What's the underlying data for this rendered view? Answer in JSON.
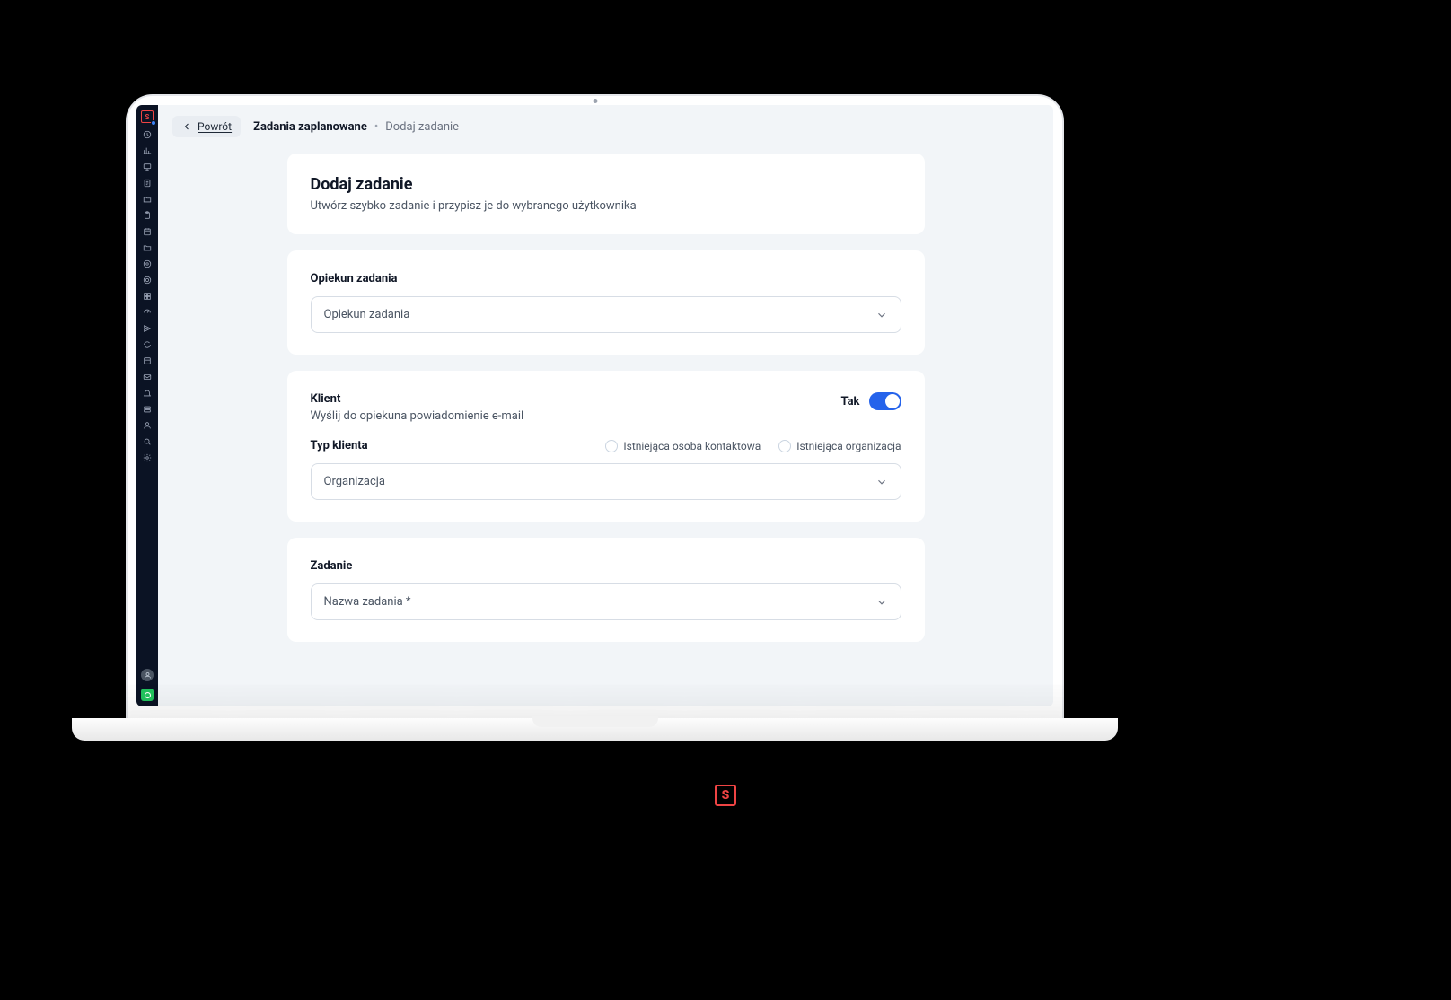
{
  "topbar": {
    "back_label": "Powrót"
  },
  "breadcrumb": {
    "root": "Zadania zaplanowane",
    "current": "Dodaj zadanie"
  },
  "header_panel": {
    "title": "Dodaj zadanie",
    "subtitle": "Utwórz szybko zadanie i przypisz je do wybranego użytkownika"
  },
  "caretaker": {
    "section_label": "Opiekun zadania",
    "placeholder": "Opiekun zadania"
  },
  "client": {
    "section_label": "Klient",
    "notify_label": "Wyślij do opiekuna powiadomienie e-mail",
    "toggle_label": "Tak",
    "type_label": "Typ klienta",
    "radio_contact": "Istniejąca osoba kontaktowa",
    "radio_org": "Istniejąca organizacja",
    "type_placeholder": "Organizacja"
  },
  "task": {
    "section_label": "Zadanie",
    "name_placeholder": "Nazwa zadania *"
  },
  "icons": {
    "sidebar": [
      "clock-icon",
      "chart-icon",
      "monitor-icon",
      "document-icon",
      "folder-icon",
      "clipboard-icon",
      "calendar-icon",
      "folder2-icon",
      "at-icon",
      "target-icon",
      "grid-icon",
      "dashboard-icon",
      "send-icon",
      "refresh-icon",
      "layout-icon",
      "mail-icon",
      "bell-icon",
      "server-icon",
      "user-icon",
      "search-icon",
      "gear-icon"
    ]
  },
  "colors": {
    "accent": "#2563eb",
    "brand": "#ef4444",
    "bg": "#f2f5f8",
    "sidebar": "#0b1324"
  }
}
